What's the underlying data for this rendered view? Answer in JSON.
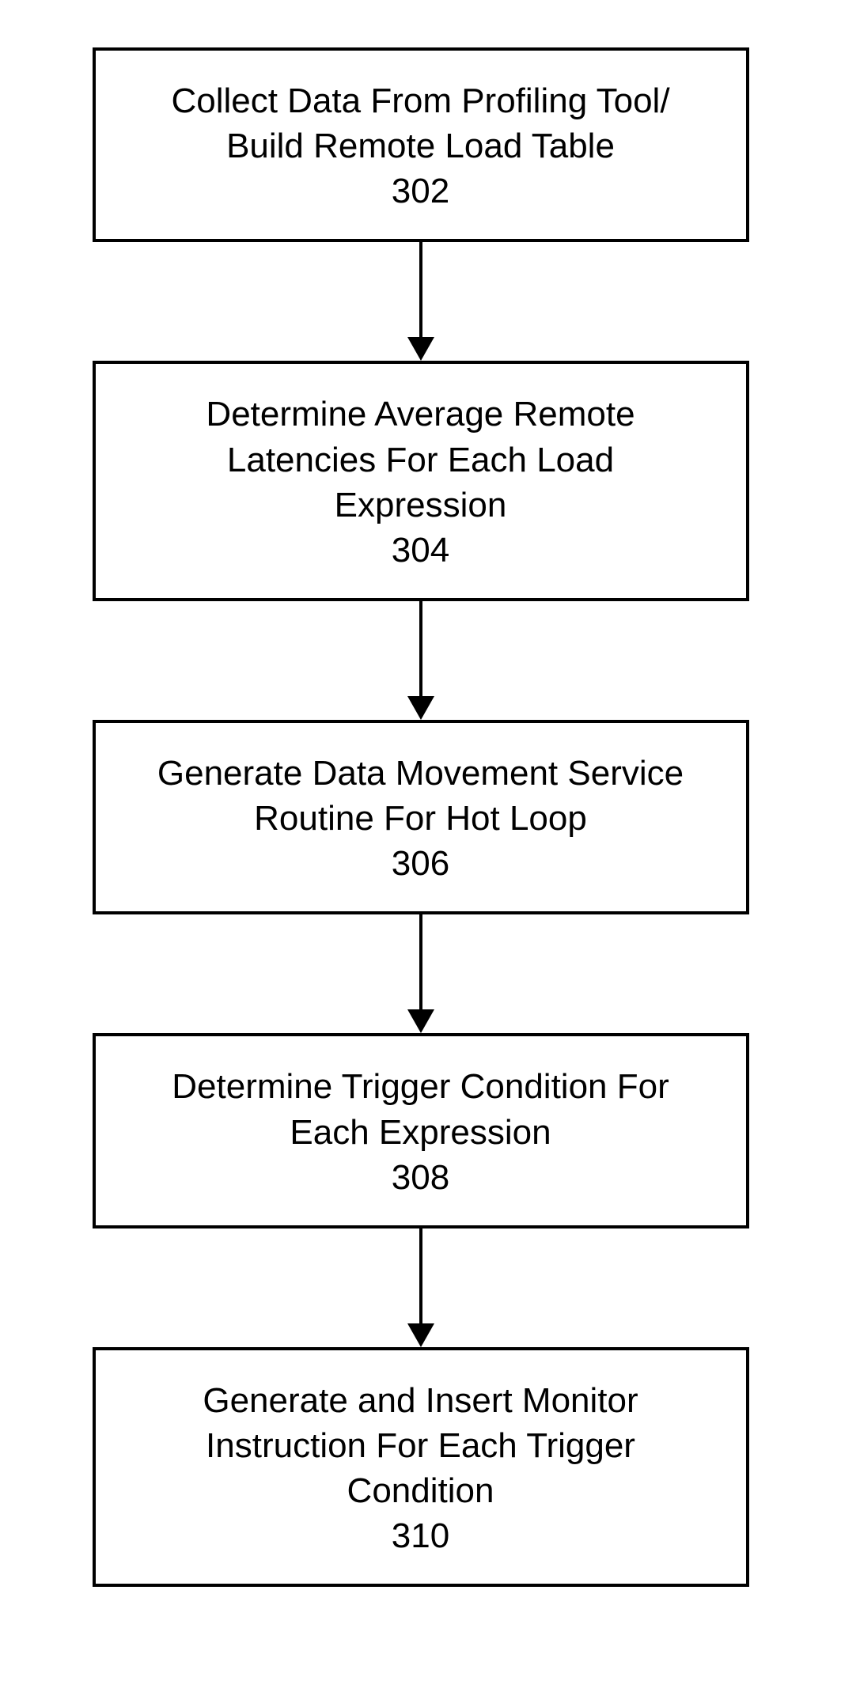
{
  "flowchart": {
    "steps": [
      {
        "text": "Collect Data From Profiling Tool/\nBuild Remote Load Table",
        "number": "302"
      },
      {
        "text": "Determine Average Remote\nLatencies For Each Load\nExpression",
        "number": "304"
      },
      {
        "text": "Generate Data Movement Service\nRoutine For Hot Loop",
        "number": "306"
      },
      {
        "text": "Determine Trigger Condition For\nEach Expression",
        "number": "308"
      },
      {
        "text": "Generate and Insert Monitor\nInstruction For Each Trigger\nCondition",
        "number": "310"
      }
    ]
  }
}
